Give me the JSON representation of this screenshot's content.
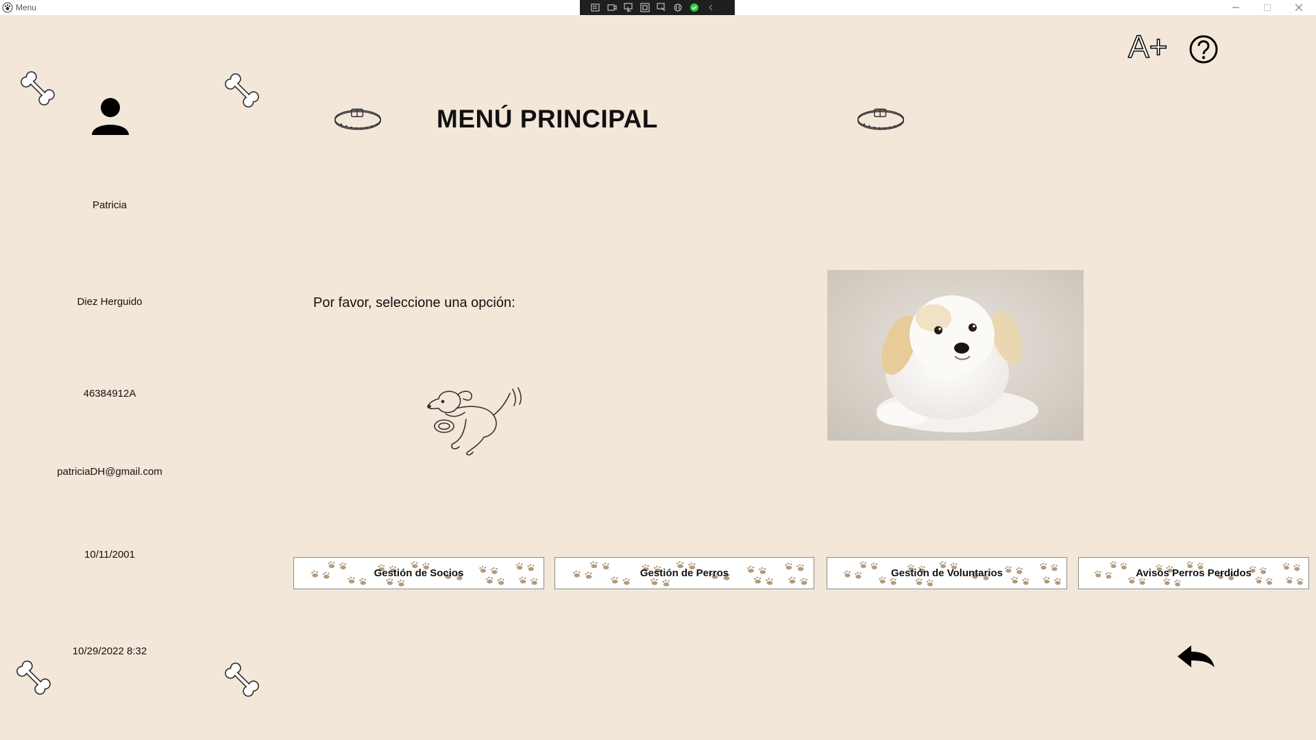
{
  "window": {
    "title": "Menu",
    "min_icon": "minimize-icon",
    "max_icon": "maximize-icon",
    "close_icon": "close-icon"
  },
  "header": {
    "title": "MENÚ PRINCIPAL",
    "font_size_label": "A+"
  },
  "profile": {
    "icon": "user-icon",
    "first_name": "Patricia",
    "last_name": "Diez Herguido",
    "dni": "46384912A",
    "email": "patriciaDH@gmail.com",
    "birth_date": "10/11/2001",
    "datetime": "10/29/2022 8:32"
  },
  "main": {
    "prompt": "Por favor, seleccione una opción:"
  },
  "menu": {
    "buttons": [
      {
        "label": "Gestión de Socios"
      },
      {
        "label": "Gestión de Perros"
      },
      {
        "label": "Gestión de Voluntarios"
      },
      {
        "label": "Avisos Perros Perdidos"
      }
    ]
  },
  "colors": {
    "background": "#f3e7d9",
    "paw": "#b39b7e",
    "toolbar": "#1e1e1e",
    "accent_check": "#2ecc40"
  }
}
